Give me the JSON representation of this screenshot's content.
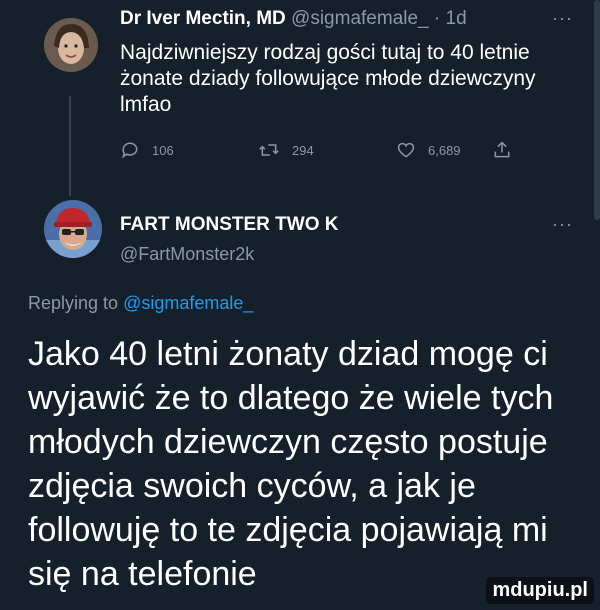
{
  "tweet1": {
    "author_name": "Dr Iver Mectin, MD",
    "handle": "@sigmafemale_",
    "time": "· 1d",
    "more": "···",
    "text": "Najdziwniejszy rodzaj gości tutaj to 40 letnie żonate dziady followujące młode dziewczyny lmfao",
    "replies": "106",
    "retweets": "294",
    "likes": "6,689"
  },
  "tweet2": {
    "author_name": "FART MONSTER TWO K",
    "handle": "@FartMonster2k",
    "more": "···",
    "replying_prefix": "Replying to",
    "replying_handle": "@sigmafemale_",
    "text": "Jako 40 letni żonaty dziad mogę ci wyjawić że to dlatego że wiele tych młodych dziewczyn często postuje zdjęcia swoich cyców, a jak je followuję to te zdjęcia pojawiają mi się na telefonie"
  },
  "watermark": "mdupiu.pl",
  "colors": {
    "background": "#15202b",
    "muted": "#8b98a5",
    "link": "#1d9bf0"
  },
  "icons": [
    "reply-icon",
    "retweet-icon",
    "like-icon",
    "share-icon",
    "more-icon"
  ]
}
